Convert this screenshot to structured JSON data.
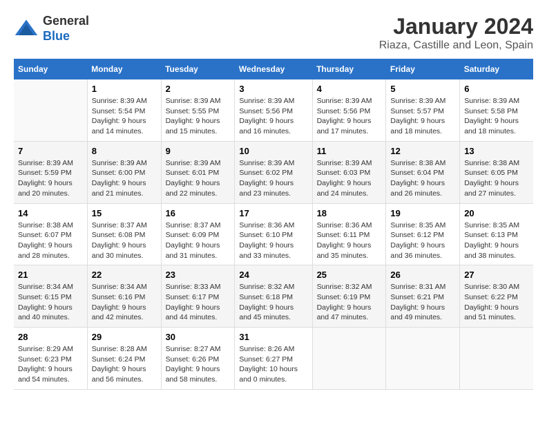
{
  "header": {
    "logo_line1": "General",
    "logo_line2": "Blue",
    "title": "January 2024",
    "subtitle": "Riaza, Castille and Leon, Spain"
  },
  "days_of_week": [
    "Sunday",
    "Monday",
    "Tuesday",
    "Wednesday",
    "Thursday",
    "Friday",
    "Saturday"
  ],
  "weeks": [
    [
      {
        "num": "",
        "content": ""
      },
      {
        "num": "1",
        "content": "Sunrise: 8:39 AM\nSunset: 5:54 PM\nDaylight: 9 hours\nand 14 minutes."
      },
      {
        "num": "2",
        "content": "Sunrise: 8:39 AM\nSunset: 5:55 PM\nDaylight: 9 hours\nand 15 minutes."
      },
      {
        "num": "3",
        "content": "Sunrise: 8:39 AM\nSunset: 5:56 PM\nDaylight: 9 hours\nand 16 minutes."
      },
      {
        "num": "4",
        "content": "Sunrise: 8:39 AM\nSunset: 5:56 PM\nDaylight: 9 hours\nand 17 minutes."
      },
      {
        "num": "5",
        "content": "Sunrise: 8:39 AM\nSunset: 5:57 PM\nDaylight: 9 hours\nand 18 minutes."
      },
      {
        "num": "6",
        "content": "Sunrise: 8:39 AM\nSunset: 5:58 PM\nDaylight: 9 hours\nand 18 minutes."
      }
    ],
    [
      {
        "num": "7",
        "content": "Sunrise: 8:39 AM\nSunset: 5:59 PM\nDaylight: 9 hours\nand 20 minutes."
      },
      {
        "num": "8",
        "content": "Sunrise: 8:39 AM\nSunset: 6:00 PM\nDaylight: 9 hours\nand 21 minutes."
      },
      {
        "num": "9",
        "content": "Sunrise: 8:39 AM\nSunset: 6:01 PM\nDaylight: 9 hours\nand 22 minutes."
      },
      {
        "num": "10",
        "content": "Sunrise: 8:39 AM\nSunset: 6:02 PM\nDaylight: 9 hours\nand 23 minutes."
      },
      {
        "num": "11",
        "content": "Sunrise: 8:39 AM\nSunset: 6:03 PM\nDaylight: 9 hours\nand 24 minutes."
      },
      {
        "num": "12",
        "content": "Sunrise: 8:38 AM\nSunset: 6:04 PM\nDaylight: 9 hours\nand 26 minutes."
      },
      {
        "num": "13",
        "content": "Sunrise: 8:38 AM\nSunset: 6:05 PM\nDaylight: 9 hours\nand 27 minutes."
      }
    ],
    [
      {
        "num": "14",
        "content": "Sunrise: 8:38 AM\nSunset: 6:07 PM\nDaylight: 9 hours\nand 28 minutes."
      },
      {
        "num": "15",
        "content": "Sunrise: 8:37 AM\nSunset: 6:08 PM\nDaylight: 9 hours\nand 30 minutes."
      },
      {
        "num": "16",
        "content": "Sunrise: 8:37 AM\nSunset: 6:09 PM\nDaylight: 9 hours\nand 31 minutes."
      },
      {
        "num": "17",
        "content": "Sunrise: 8:36 AM\nSunset: 6:10 PM\nDaylight: 9 hours\nand 33 minutes."
      },
      {
        "num": "18",
        "content": "Sunrise: 8:36 AM\nSunset: 6:11 PM\nDaylight: 9 hours\nand 35 minutes."
      },
      {
        "num": "19",
        "content": "Sunrise: 8:35 AM\nSunset: 6:12 PM\nDaylight: 9 hours\nand 36 minutes."
      },
      {
        "num": "20",
        "content": "Sunrise: 8:35 AM\nSunset: 6:13 PM\nDaylight: 9 hours\nand 38 minutes."
      }
    ],
    [
      {
        "num": "21",
        "content": "Sunrise: 8:34 AM\nSunset: 6:15 PM\nDaylight: 9 hours\nand 40 minutes."
      },
      {
        "num": "22",
        "content": "Sunrise: 8:34 AM\nSunset: 6:16 PM\nDaylight: 9 hours\nand 42 minutes."
      },
      {
        "num": "23",
        "content": "Sunrise: 8:33 AM\nSunset: 6:17 PM\nDaylight: 9 hours\nand 44 minutes."
      },
      {
        "num": "24",
        "content": "Sunrise: 8:32 AM\nSunset: 6:18 PM\nDaylight: 9 hours\nand 45 minutes."
      },
      {
        "num": "25",
        "content": "Sunrise: 8:32 AM\nSunset: 6:19 PM\nDaylight: 9 hours\nand 47 minutes."
      },
      {
        "num": "26",
        "content": "Sunrise: 8:31 AM\nSunset: 6:21 PM\nDaylight: 9 hours\nand 49 minutes."
      },
      {
        "num": "27",
        "content": "Sunrise: 8:30 AM\nSunset: 6:22 PM\nDaylight: 9 hours\nand 51 minutes."
      }
    ],
    [
      {
        "num": "28",
        "content": "Sunrise: 8:29 AM\nSunset: 6:23 PM\nDaylight: 9 hours\nand 54 minutes."
      },
      {
        "num": "29",
        "content": "Sunrise: 8:28 AM\nSunset: 6:24 PM\nDaylight: 9 hours\nand 56 minutes."
      },
      {
        "num": "30",
        "content": "Sunrise: 8:27 AM\nSunset: 6:26 PM\nDaylight: 9 hours\nand 58 minutes."
      },
      {
        "num": "31",
        "content": "Sunrise: 8:26 AM\nSunset: 6:27 PM\nDaylight: 10 hours\nand 0 minutes."
      },
      {
        "num": "",
        "content": ""
      },
      {
        "num": "",
        "content": ""
      },
      {
        "num": "",
        "content": ""
      }
    ]
  ]
}
